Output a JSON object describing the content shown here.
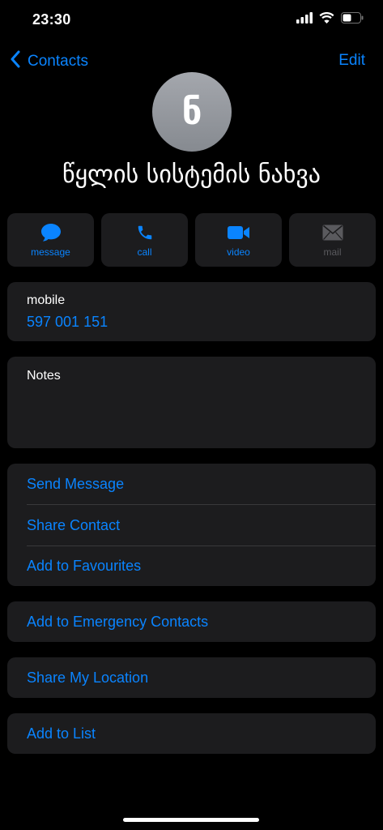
{
  "status_bar": {
    "time": "23:30"
  },
  "nav": {
    "back_label": "Contacts",
    "edit_label": "Edit"
  },
  "contact": {
    "initial": "ნ",
    "name": "წყლის სისტემის ნახვა"
  },
  "actions": [
    {
      "label": "message",
      "icon": "message-bubble-icon"
    },
    {
      "label": "call",
      "icon": "phone-icon"
    },
    {
      "label": "video",
      "icon": "video-camera-icon"
    },
    {
      "label": "mail",
      "icon": "envelope-icon"
    }
  ],
  "phone": {
    "label": "mobile",
    "value": "597 001 151"
  },
  "notes": {
    "label": "Notes"
  },
  "options": {
    "send_message": "Send Message",
    "share_contact": "Share Contact",
    "add_to_favourites": "Add to Favourites",
    "add_to_emergency": "Add to Emergency Contacts",
    "share_location": "Share My Location",
    "add_to_list": "Add to List"
  },
  "colors": {
    "accent": "#0a84ff",
    "card": "#1c1c1e",
    "disabled": "#5a5a5e"
  }
}
